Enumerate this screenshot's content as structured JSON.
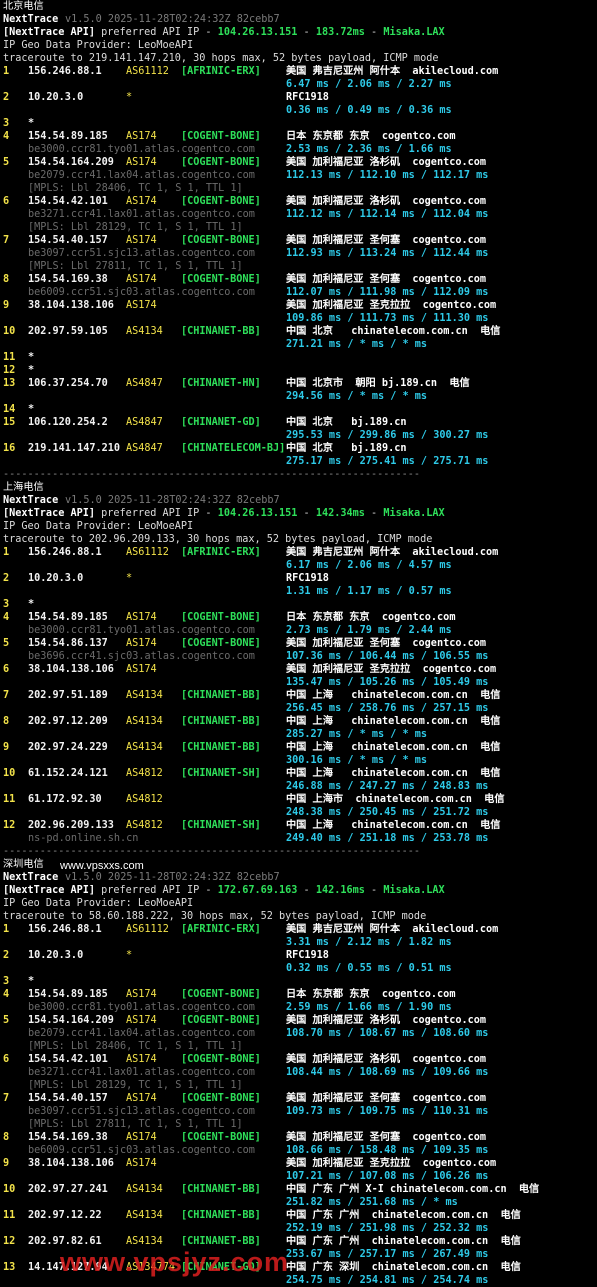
{
  "sections": [
    {
      "title": "北京电信",
      "app": "NextTrace",
      "version": "v1.5.0 2025-11-28T02:24:32Z 82cebb7",
      "api_prefix": "[NextTrace API]",
      "api_mid": " preferred API IP - ",
      "api_ip": "104.26.13.151",
      "api_dash": " - ",
      "api_ms": "183.72ms",
      "api_dash2": " - ",
      "api_node": "Misaka.LAX",
      "geo_provider": "IP Geo Data Provider: LeoMoeAPI",
      "traceroute": "traceroute to 219.141.147.210, 30 hops max, 52 bytes payload, ICMP mode",
      "hops": [
        {
          "n": "1",
          "ip": "156.246.88.1",
          "as": "AS61112",
          "tag": "[AFRINIC-ERX]",
          "geo": "美国 弗吉尼亚州 阿什本  akilecloud.com",
          "rtt": "6.47 ms / 2.06 ms / 2.27 ms",
          "host": "",
          "mpls": ""
        },
        {
          "n": "2",
          "ip": "10.20.3.0",
          "as": "*",
          "tag": "",
          "geo": "RFC1918",
          "rtt": "0.36 ms / 0.49 ms / 0.36 ms",
          "host": "",
          "mpls": ""
        },
        {
          "n": "3",
          "ip": "*",
          "as": "",
          "tag": "",
          "geo": "",
          "rtt": "",
          "host": "",
          "mpls": ""
        },
        {
          "n": "4",
          "ip": "154.54.89.185",
          "as": "AS174",
          "tag": "[COGENT-BONE]",
          "geo": "日本 东京都 东京  cogentco.com",
          "rtt": "2.53 ms / 2.36 ms / 1.66 ms",
          "host": "be3000.ccr81.tyo01.atlas.cogentco.com",
          "mpls": ""
        },
        {
          "n": "5",
          "ip": "154.54.164.209",
          "as": "AS174",
          "tag": "[COGENT-BONE]",
          "geo": "美国 加利福尼亚 洛杉矶  cogentco.com",
          "rtt": "112.13 ms / 112.10 ms / 112.17 ms",
          "host": "be2079.ccr41.lax04.atlas.cogentco.com",
          "mpls": "[MPLS: Lbl 28406, TC 1, S 1, TTL 1]"
        },
        {
          "n": "6",
          "ip": "154.54.42.101",
          "as": "AS174",
          "tag": "[COGENT-BONE]",
          "geo": "美国 加利福尼亚 洛杉矶  cogentco.com",
          "rtt": "112.12 ms / 112.14 ms / 112.04 ms",
          "host": "be3271.ccr41.lax01.atlas.cogentco.com",
          "mpls": "[MPLS: Lbl 28129, TC 1, S 1, TTL 1]"
        },
        {
          "n": "7",
          "ip": "154.54.40.157",
          "as": "AS174",
          "tag": "[COGENT-BONE]",
          "geo": "美国 加利福尼亚 圣何塞  cogentco.com",
          "rtt": "112.93 ms / 113.24 ms / 112.44 ms",
          "host": "be3097.ccr51.sjc13.atlas.cogentco.com",
          "mpls": "[MPLS: Lbl 27811, TC 1, S 1, TTL 1]"
        },
        {
          "n": "8",
          "ip": "154.54.169.38",
          "as": "AS174",
          "tag": "[COGENT-BONE]",
          "geo": "美国 加利福尼亚 圣何塞  cogentco.com",
          "rtt": "112.07 ms / 111.98 ms / 112.09 ms",
          "host": "be6009.ccr51.sjc03.atlas.cogentco.com",
          "mpls": ""
        },
        {
          "n": "9",
          "ip": "38.104.138.106",
          "as": "AS174",
          "tag": "",
          "geo": "美国 加利福尼亚 圣克拉拉  cogentco.com",
          "rtt": "109.86 ms / 111.73 ms / 111.30 ms",
          "host": "",
          "mpls": ""
        },
        {
          "n": "10",
          "ip": "202.97.59.105",
          "as": "AS4134",
          "tag": "[CHINANET-BB]",
          "geo": "中国 北京   chinatelecom.com.cn  电信",
          "rtt": "271.21 ms / * ms / * ms",
          "host": "",
          "mpls": ""
        },
        {
          "n": "11",
          "ip": "*",
          "as": "",
          "tag": "",
          "geo": "",
          "rtt": "",
          "host": "",
          "mpls": ""
        },
        {
          "n": "12",
          "ip": "*",
          "as": "",
          "tag": "",
          "geo": "",
          "rtt": "",
          "host": "",
          "mpls": ""
        },
        {
          "n": "13",
          "ip": "106.37.254.70",
          "as": "AS4847",
          "tag": "[CHINANET-HN]",
          "geo": "中国 北京市  朝阳 bj.189.cn  电信",
          "rtt": "294.56 ms / * ms / * ms",
          "host": "",
          "mpls": ""
        },
        {
          "n": "14",
          "ip": "*",
          "as": "",
          "tag": "",
          "geo": "",
          "rtt": "",
          "host": "",
          "mpls": ""
        },
        {
          "n": "15",
          "ip": "106.120.254.2",
          "as": "AS4847",
          "tag": "[CHINANET-GD]",
          "geo": "中国 北京   bj.189.cn",
          "rtt": "295.53 ms / 299.86 ms / 300.27 ms",
          "host": "",
          "mpls": ""
        },
        {
          "n": "16",
          "ip": "219.141.147.210",
          "as": "AS4847",
          "tag": "[CHINATELECOM-BJ]",
          "geo": "中国 北京   bj.189.cn",
          "rtt": "275.17 ms / 275.41 ms / 275.71 ms",
          "host": "",
          "mpls": ""
        }
      ]
    },
    {
      "title": "上海电信",
      "app": "NextTrace",
      "version": "v1.5.0 2025-11-28T02:24:32Z 82cebb7",
      "api_prefix": "[NextTrace API]",
      "api_mid": " preferred API IP - ",
      "api_ip": "104.26.13.151",
      "api_dash": " - ",
      "api_ms": "142.34ms",
      "api_dash2": " - ",
      "api_node": "Misaka.LAX",
      "geo_provider": "IP Geo Data Provider: LeoMoeAPI",
      "traceroute": "traceroute to 202.96.209.133, 30 hops max, 52 bytes payload, ICMP mode",
      "hops": [
        {
          "n": "1",
          "ip": "156.246.88.1",
          "as": "AS61112",
          "tag": "[AFRINIC-ERX]",
          "geo": "美国 弗吉尼亚州 阿什本  akilecloud.com",
          "rtt": "6.17 ms / 2.06 ms / 4.57 ms",
          "host": "",
          "mpls": ""
        },
        {
          "n": "2",
          "ip": "10.20.3.0",
          "as": "*",
          "tag": "",
          "geo": "RFC1918",
          "rtt": "1.31 ms / 1.17 ms / 0.57 ms",
          "host": "",
          "mpls": ""
        },
        {
          "n": "3",
          "ip": "*",
          "as": "",
          "tag": "",
          "geo": "",
          "rtt": "",
          "host": "",
          "mpls": ""
        },
        {
          "n": "4",
          "ip": "154.54.89.185",
          "as": "AS174",
          "tag": "[COGENT-BONE]",
          "geo": "日本 东京都 东京  cogentco.com",
          "rtt": "2.73 ms / 1.79 ms / 2.44 ms",
          "host": "be3000.ccr81.tyo01.atlas.cogentco.com",
          "mpls": ""
        },
        {
          "n": "5",
          "ip": "154.54.86.137",
          "as": "AS174",
          "tag": "[COGENT-BONE]",
          "geo": "美国 加利福尼亚 圣何塞  cogentco.com",
          "rtt": "107.36 ms / 106.44 ms / 106.55 ms",
          "host": "be3696.ccr41.sjc03.atlas.cogentco.com",
          "mpls": ""
        },
        {
          "n": "6",
          "ip": "38.104.138.106",
          "as": "AS174",
          "tag": "",
          "geo": "美国 加利福尼亚 圣克拉拉  cogentco.com",
          "rtt": "135.47 ms / 105.26 ms / 105.49 ms",
          "host": "",
          "mpls": ""
        },
        {
          "n": "7",
          "ip": "202.97.51.189",
          "as": "AS4134",
          "tag": "[CHINANET-BB]",
          "geo": "中国 上海   chinatelecom.com.cn  电信",
          "rtt": "256.45 ms / 258.76 ms / 257.15 ms",
          "host": "",
          "mpls": ""
        },
        {
          "n": "8",
          "ip": "202.97.12.209",
          "as": "AS4134",
          "tag": "[CHINANET-BB]",
          "geo": "中国 上海   chinatelecom.com.cn  电信",
          "rtt": "285.27 ms / * ms / * ms",
          "host": "",
          "mpls": ""
        },
        {
          "n": "9",
          "ip": "202.97.24.229",
          "as": "AS4134",
          "tag": "[CHINANET-BB]",
          "geo": "中国 上海   chinatelecom.com.cn  电信",
          "rtt": "300.16 ms / * ms / * ms",
          "host": "",
          "mpls": ""
        },
        {
          "n": "10",
          "ip": "61.152.24.121",
          "as": "AS4812",
          "tag": "[CHINANET-SH]",
          "geo": "中国 上海   chinatelecom.com.cn  电信",
          "rtt": "246.88 ms / 247.27 ms / 248.83 ms",
          "host": "",
          "mpls": ""
        },
        {
          "n": "11",
          "ip": "61.172.92.30",
          "as": "AS4812",
          "tag": "",
          "geo": "中国 上海市  chinatelecom.com.cn  电信",
          "rtt": "248.38 ms / 250.45 ms / 251.72 ms",
          "host": "",
          "mpls": ""
        },
        {
          "n": "12",
          "ip": "202.96.209.133",
          "as": "AS4812",
          "tag": "[CHINANET-SH]",
          "geo": "中国 上海   chinatelecom.com.cn  电信",
          "rtt": "249.40 ms / 251.18 ms / 253.78 ms",
          "host": "ns-pd.online.sh.cn",
          "mpls": ""
        }
      ]
    },
    {
      "title": "深圳电信",
      "app": "NextTrace",
      "version": "v1.5.0 2025-11-28T02:24:32Z 82cebb7",
      "api_prefix": "[NextTrace API]",
      "api_mid": " preferred API IP - ",
      "api_ip": "172.67.69.163",
      "api_dash": " - ",
      "api_ms": "142.16ms",
      "api_dash2": " - ",
      "api_node": "Misaka.LAX",
      "geo_provider": "IP Geo Data Provider: LeoMoeAPI",
      "traceroute": "traceroute to 58.60.188.222, 30 hops max, 52 bytes payload, ICMP mode",
      "hops": [
        {
          "n": "1",
          "ip": "156.246.88.1",
          "as": "AS61112",
          "tag": "[AFRINIC-ERX]",
          "geo": "美国 弗吉尼亚州 阿什本  akilecloud.com",
          "rtt": "3.31 ms / 2.12 ms / 1.82 ms",
          "host": "",
          "mpls": ""
        },
        {
          "n": "2",
          "ip": "10.20.3.0",
          "as": "*",
          "tag": "",
          "geo": "RFC1918",
          "rtt": "0.32 ms / 0.55 ms / 0.51 ms",
          "host": "",
          "mpls": ""
        },
        {
          "n": "3",
          "ip": "*",
          "as": "",
          "tag": "",
          "geo": "",
          "rtt": "",
          "host": "",
          "mpls": ""
        },
        {
          "n": "4",
          "ip": "154.54.89.185",
          "as": "AS174",
          "tag": "[COGENT-BONE]",
          "geo": "日本 东京都 东京  cogentco.com",
          "rtt": "2.59 ms / 1.66 ms / 1.90 ms",
          "host": "be3000.ccr81.tyo01.atlas.cogentco.com",
          "mpls": ""
        },
        {
          "n": "5",
          "ip": "154.54.164.209",
          "as": "AS174",
          "tag": "[COGENT-BONE]",
          "geo": "美国 加利福尼亚 洛杉矶  cogentco.com",
          "rtt": "108.70 ms / 108.67 ms / 108.60 ms",
          "host": "be2079.ccr41.lax04.atlas.cogentco.com",
          "mpls": "[MPLS: Lbl 28406, TC 1, S 1, TTL 1]"
        },
        {
          "n": "6",
          "ip": "154.54.42.101",
          "as": "AS174",
          "tag": "[COGENT-BONE]",
          "geo": "美国 加利福尼亚 洛杉矶  cogentco.com",
          "rtt": "108.44 ms / 108.69 ms / 109.66 ms",
          "host": "be3271.ccr41.lax01.atlas.cogentco.com",
          "mpls": "[MPLS: Lbl 28129, TC 1, S 1, TTL 1]"
        },
        {
          "n": "7",
          "ip": "154.54.40.157",
          "as": "AS174",
          "tag": "[COGENT-BONE]",
          "geo": "美国 加利福尼亚 圣何塞  cogentco.com",
          "rtt": "109.73 ms / 109.75 ms / 110.31 ms",
          "host": "be3097.ccr51.sjc13.atlas.cogentco.com",
          "mpls": "[MPLS: Lbl 27811, TC 1, S 1, TTL 1]"
        },
        {
          "n": "8",
          "ip": "154.54.169.38",
          "as": "AS174",
          "tag": "[COGENT-BONE]",
          "geo": "美国 加利福尼亚 圣何塞  cogentco.com",
          "rtt": "108.66 ms / 158.48 ms / 109.35 ms",
          "host": "be6009.ccr51.sjc03.atlas.cogentco.com",
          "mpls": ""
        },
        {
          "n": "9",
          "ip": "38.104.138.106",
          "as": "AS174",
          "tag": "",
          "geo": "美国 加利福尼亚 圣克拉拉  cogentco.com",
          "rtt": "107.21 ms / 107.08 ms / 106.26 ms",
          "host": "",
          "mpls": ""
        },
        {
          "n": "10",
          "ip": "202.97.27.241",
          "as": "AS4134",
          "tag": "[CHINANET-BB]",
          "geo": "中国 广东 广州 X-I chinatelecom.com.cn  电信",
          "rtt": "251.82 ms / 251.68 ms / * ms",
          "host": "",
          "mpls": ""
        },
        {
          "n": "11",
          "ip": "202.97.12.22",
          "as": "AS4134",
          "tag": "[CHINANET-BB]",
          "geo": "中国 广东 广州  chinatelecom.com.cn  电信",
          "rtt": "252.19 ms / 251.98 ms / 252.32 ms",
          "host": "",
          "mpls": ""
        },
        {
          "n": "12",
          "ip": "202.97.82.61",
          "as": "AS4134",
          "tag": "[CHINANET-BB]",
          "geo": "中国 广东 广州  chinatelecom.com.cn  电信",
          "rtt": "253.67 ms / 257.17 ms / 267.49 ms",
          "host": "",
          "mpls": ""
        },
        {
          "n": "13",
          "ip": "14.147.127.94",
          "as": "AS134774",
          "tag": "[CHINANET-GD]",
          "geo": "中国 广东 深圳  chinatelecom.com.cn  电信",
          "rtt": "254.75 ms / 254.81 ms / 254.74 ms",
          "host": "",
          "mpls": ""
        }
      ]
    }
  ],
  "separator": "--------------------------------------------------------------------",
  "watermark_small": "www.vpsxxs.com",
  "watermark_big": "www.vpsjyz.com",
  "colors": {
    "background": "#000000",
    "number": "#f2e24a",
    "asn": "#f2e24a",
    "tag": "#2ee05a",
    "rtt": "#2ecae8",
    "host": "#6b6b6b",
    "watermark": "#dc1e1e"
  }
}
